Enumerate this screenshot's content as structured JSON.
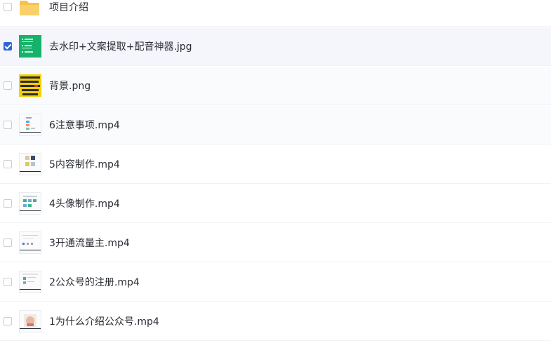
{
  "files": [
    {
      "name": "项目介绍",
      "type": "folder",
      "checked": false
    },
    {
      "name": "去水印+文案提取+配音神器.jpg",
      "type": "image-green",
      "checked": true
    },
    {
      "name": "背景.png",
      "type": "image-yellow",
      "checked": false
    },
    {
      "name": "6注意事项.mp4",
      "type": "video",
      "checked": false
    },
    {
      "name": "5内容制作.mp4",
      "type": "video",
      "checked": false
    },
    {
      "name": "4头像制作.mp4",
      "type": "video",
      "checked": false
    },
    {
      "name": "3开通流量主.mp4",
      "type": "video",
      "checked": false
    },
    {
      "name": "2公众号的注册.mp4",
      "type": "video",
      "checked": false
    },
    {
      "name": "1为什么介绍公众号.mp4",
      "type": "video",
      "checked": false
    }
  ],
  "colors": {
    "accent": "#2f63d9",
    "folder": "#f6c24b",
    "green_thumb": "#17b26a",
    "yellow_thumb": "#f5d000"
  }
}
